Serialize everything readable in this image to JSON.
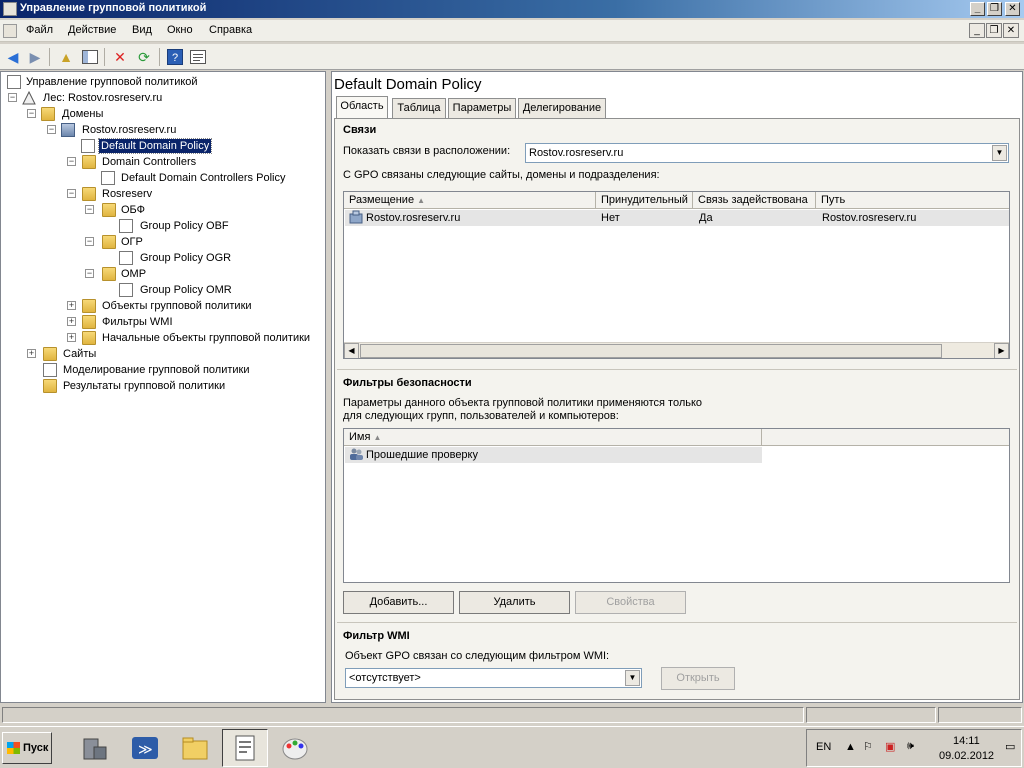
{
  "window": {
    "title": "Управление групповой политикой"
  },
  "menu": [
    "Файл",
    "Действие",
    "Вид",
    "Окно",
    "Справка"
  ],
  "toolbar_icons": [
    "back-arrow-icon",
    "forward-arrow-icon",
    "up-folder-icon",
    "show-tree-icon",
    "delete-icon",
    "refresh-icon",
    "help-icon",
    "properties-icon"
  ],
  "tree": {
    "root": "Управление групповой политикой",
    "forest": "Лес: Rostov.rosreserv.ru",
    "domains": "Домены",
    "domain": "Rostov.rosreserv.ru",
    "default_policy": "Default Domain Policy",
    "dc_ou": "Domain Controllers",
    "dc_policy": "Default Domain Controllers Policy",
    "rosreserv": "Rosreserv",
    "obf": "ОБФ",
    "obf_policy": "Group Policy OBF",
    "ogr": "ОГР",
    "ogr_policy": "Group Policy OGR",
    "omr": "ОМР",
    "omr_policy": "Group Policy OMR",
    "gpo_objects": "Объекты групповой политики",
    "wmi_filters": "Фильтры WMI",
    "starter_gpos": "Начальные объекты групповой политики",
    "sites": "Сайты",
    "modeling": "Моделирование групповой политики",
    "results": "Результаты групповой политики"
  },
  "details": {
    "title": "Default Domain Policy",
    "tabs": [
      "Область",
      "Таблица",
      "Параметры",
      "Делегирование"
    ],
    "links": {
      "heading": "Связи",
      "show_label": "Показать связи в расположении:",
      "location": "Rostov.rosreserv.ru",
      "description": "С GPO связаны следующие сайты, домены и подразделения:",
      "columns": [
        "Размещение",
        "Принудительный",
        "Связь задействована",
        "Путь"
      ],
      "rows": [
        {
          "location": "Rostov.rosreserv.ru",
          "enforced": "Нет",
          "enabled": "Да",
          "path": "Rostov.rosreserv.ru"
        }
      ]
    },
    "security": {
      "heading": "Фильтры безопасности",
      "description_line1": "Параметры данного объекта групповой политики применяются только",
      "description_line2": "для следующих групп, пользователей и компьютеров:",
      "column": "Имя",
      "rows": [
        "Прошедшие проверку"
      ],
      "buttons": {
        "add": "Добавить...",
        "remove": "Удалить",
        "properties": "Свойства"
      }
    },
    "wmi": {
      "heading": "Фильтр WMI",
      "description": "Объект GPO связан со следующим фильтром WMI:",
      "value": "<отсутствует>",
      "open": "Открыть"
    }
  },
  "taskbar": {
    "start": "Пуск",
    "lang": "EN",
    "time": "14:11",
    "date": "09.02.2012"
  }
}
